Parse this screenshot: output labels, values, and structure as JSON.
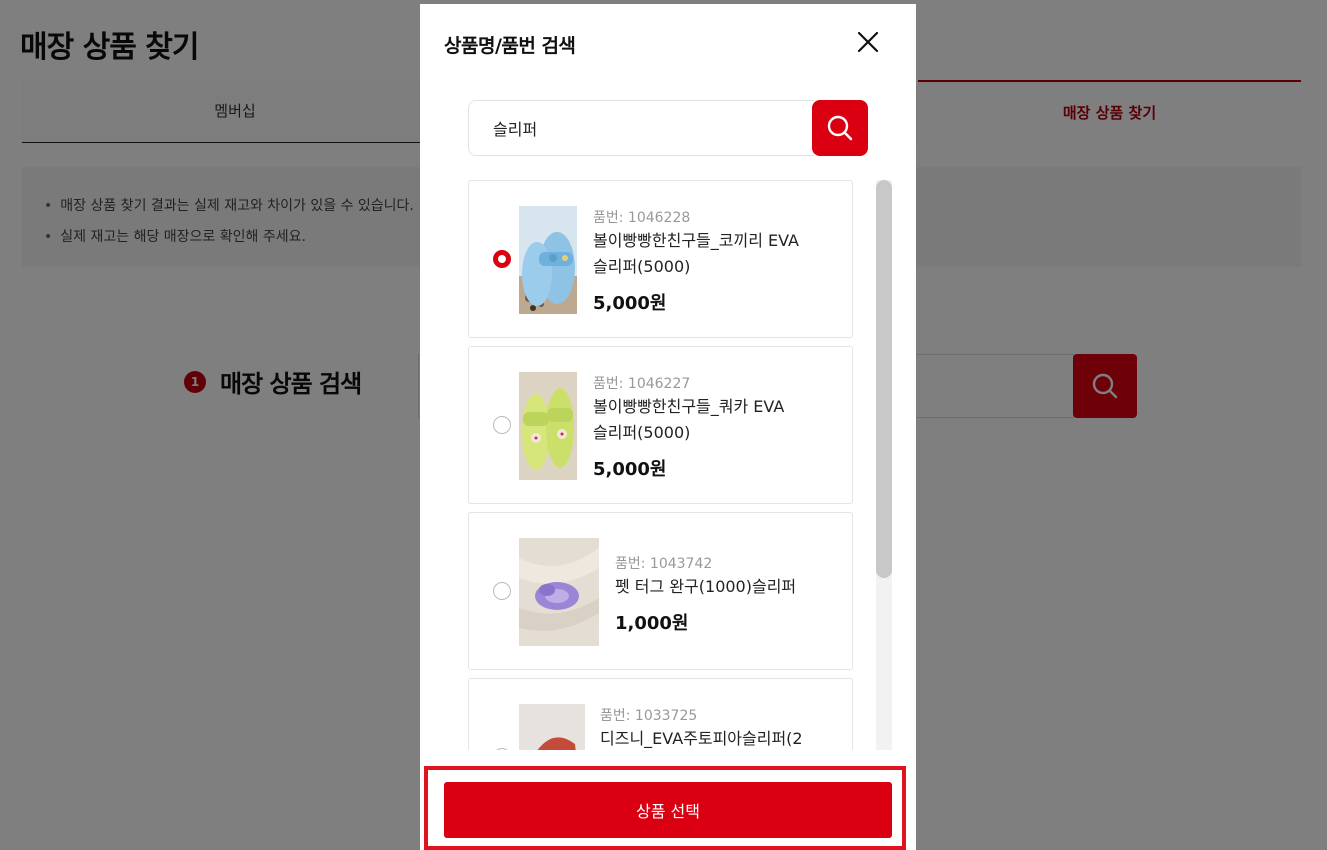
{
  "page": {
    "title": "매장 상품 찾기",
    "tabs": [
      {
        "label": "멤버십"
      },
      {
        "label": "매장 상품 찾기",
        "active": true
      }
    ],
    "notices": [
      "매장 상품 찾기 결과는 실제 재고와 차이가 있을 수 있습니다.",
      "실제 재고는 해당 매장으로 확인해 주세요."
    ],
    "search_section": {
      "step": "1",
      "title": "매장 상품 검색"
    }
  },
  "modal": {
    "title": "상품명/품번 검색",
    "search_value": "슬리퍼",
    "results": [
      {
        "item_no": "품번: 1046228",
        "name_line1": "볼이빵빵한친구들_코끼리 EVA",
        "name_line2": "슬리퍼(5000)",
        "price": "5,000원",
        "selected": true
      },
      {
        "item_no": "품번: 1046227",
        "name_line1": "볼이빵빵한친구들_쿼카 EVA",
        "name_line2": "슬리퍼(5000)",
        "price": "5,000원",
        "selected": false
      },
      {
        "item_no": "품번: 1043742",
        "name_line1": "펫 터그 완구(1000)슬리퍼",
        "name_line2": "",
        "price": "1,000원",
        "selected": false
      },
      {
        "item_no": "품번: 1033725",
        "name_line1": "디즈니_EVA주토피아슬리퍼(2",
        "name_line2": "",
        "price": "",
        "selected": false
      }
    ],
    "select_button": "상품 선택"
  },
  "colors": {
    "accent": "#da0012",
    "tab_active": "#b3000f",
    "overlay": "rgba(0,0,0,0.5)"
  },
  "icons": [
    "close-icon",
    "search-icon",
    "radio-selected-icon",
    "radio-unselected-icon"
  ]
}
